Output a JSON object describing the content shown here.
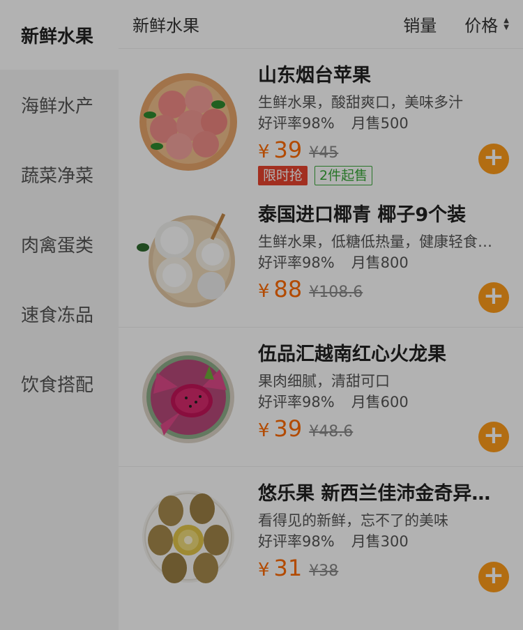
{
  "sidebar": {
    "items": [
      {
        "label": "新鲜水果"
      },
      {
        "label": "海鲜水产"
      },
      {
        "label": "蔬菜净菜"
      },
      {
        "label": "肉禽蛋类"
      },
      {
        "label": "速食冻品"
      },
      {
        "label": "饮食搭配"
      }
    ]
  },
  "sortbar": {
    "category": "新鲜水果",
    "sales": "销量",
    "price": "价格"
  },
  "currency": "¥",
  "add_symbol": "+",
  "products": [
    {
      "title": "山东烟台苹果",
      "desc": "生鲜水果，酸甜爽口，美味多汁",
      "rating": "好评率98%",
      "sold": "月售500",
      "price": "39",
      "orig_price": "¥45",
      "tags": [
        "限时抢",
        "2件起售"
      ]
    },
    {
      "title": "泰国进口椰青 椰子9个装",
      "desc": "生鲜水果，低糖低热量，健康轻食…",
      "rating": "好评率98%",
      "sold": "月售800",
      "price": "88",
      "orig_price": "¥108.6"
    },
    {
      "title": "伍品汇越南红心火龙果",
      "desc": "果肉细腻，清甜可口",
      "rating": "好评率98%",
      "sold": "月售600",
      "price": "39",
      "orig_price": "¥48.6"
    },
    {
      "title": "悠乐果 新西兰佳沛金奇异…",
      "desc": "看得见的新鲜，忘不了的美味",
      "rating": "好评率98%",
      "sold": "月售300",
      "price": "31",
      "orig_price": "¥38"
    }
  ]
}
